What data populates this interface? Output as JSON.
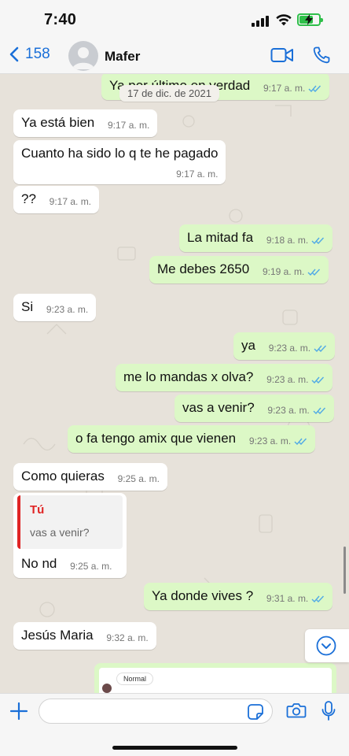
{
  "status_bar": {
    "time": "7:40"
  },
  "header": {
    "back_count": "158",
    "contact_name": "Mafer"
  },
  "date_separator": "17 de dic. de 2021",
  "colors": {
    "accent": "#1a6fd8",
    "outgoing_bubble": "#dcf8c6",
    "incoming_bubble": "#ffffff",
    "read_ticks": "#4fa9e6",
    "reply_author": "#e02424",
    "battery": "#2fbf4a"
  },
  "messages": [
    {
      "direction": "out",
      "text": "Ya por último en verdad",
      "time": "9:17 a. m."
    },
    {
      "direction": "in",
      "text": "Ya está bien",
      "time": "9:17 a. m."
    },
    {
      "direction": "in",
      "text": "Cuanto ha sido lo q te he pagado",
      "time": "9:17 a. m."
    },
    {
      "direction": "in",
      "text": "??",
      "time": "9:17 a. m."
    },
    {
      "direction": "out",
      "text": "La mitad fa",
      "time": "9:18 a. m."
    },
    {
      "direction": "out",
      "text": "Me debes 2650",
      "time": "9:19 a. m."
    },
    {
      "direction": "in",
      "text": "Si",
      "time": "9:23 a. m."
    },
    {
      "direction": "out",
      "text": "ya",
      "time": "9:23 a. m."
    },
    {
      "direction": "out",
      "text": "me lo mandas x olva?",
      "time": "9:23 a. m."
    },
    {
      "direction": "out",
      "text": "vas a venir?",
      "time": "9:23 a. m."
    },
    {
      "direction": "out",
      "text": "o fa tengo amix que vienen",
      "time": "9:23 a. m."
    },
    {
      "direction": "in",
      "text": "Como quieras",
      "time": "9:25 a. m."
    },
    {
      "direction": "in",
      "text": "No nd",
      "time": "9:25 a. m.",
      "reply_author": "Tú",
      "reply_text": "vas a venir?"
    },
    {
      "direction": "out",
      "text": "Ya donde vives ?",
      "time": "9:31 a. m."
    },
    {
      "direction": "in",
      "text": "Jesús Maria",
      "time": "9:32 a. m."
    }
  ],
  "partial_message": {
    "label": "Normal"
  },
  "input": {
    "placeholder": ""
  },
  "icons": [
    "back-chevron-icon",
    "contact-avatar-icon",
    "video-call-icon",
    "phone-icon",
    "scroll-down-icon",
    "plus-icon",
    "sticker-icon",
    "camera-icon",
    "microphone-icon"
  ]
}
